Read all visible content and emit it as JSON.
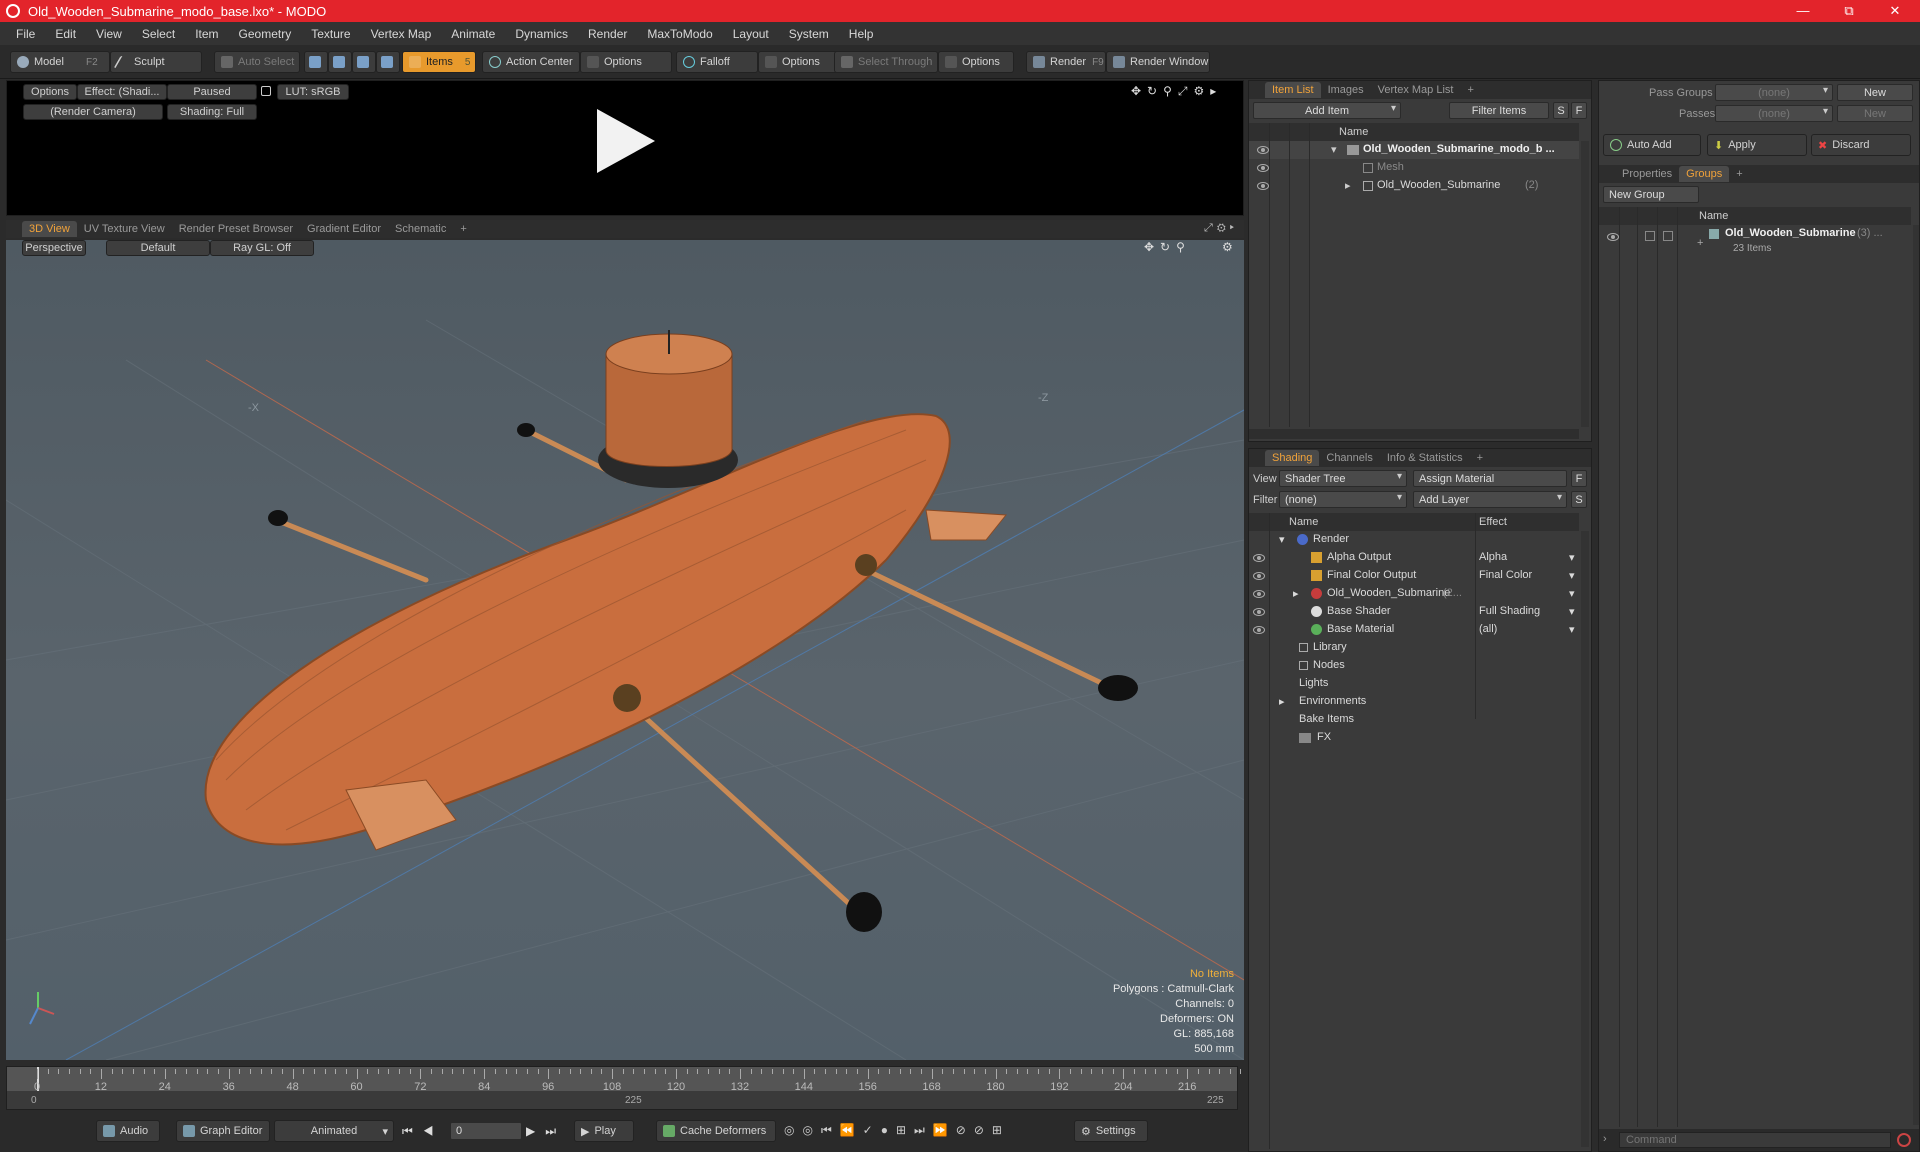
{
  "window": {
    "title": "Old_Wooden_Submarine_modo_base.lxo* - MODO",
    "minimize": "—",
    "maximize": "⧉",
    "close": "✕"
  },
  "menu": [
    "File",
    "Edit",
    "View",
    "Select",
    "Item",
    "Geometry",
    "Texture",
    "Vertex Map",
    "Animate",
    "Dynamics",
    "Render",
    "MaxToModo",
    "Layout",
    "System",
    "Help"
  ],
  "toolbar": {
    "model": "Model",
    "model_key": "F2",
    "sculpt": "Sculpt",
    "auto_select": "Auto Select",
    "items": "Items",
    "items_key": "5",
    "action_center": "Action Center",
    "options1": "Options",
    "falloff": "Falloff",
    "options2": "Options",
    "select_through": "Select Through",
    "options3": "Options",
    "render": "Render",
    "render_key": "F9",
    "render_window": "Render Window"
  },
  "preview": {
    "options": "Options",
    "effect": "Effect: (Shadi...",
    "paused": "Paused",
    "lut": "LUT: sRGB",
    "camera": "(Render Camera)",
    "shading": "Shading: Full"
  },
  "view_tabs": [
    "3D View",
    "UV Texture View",
    "Render Preset Browser",
    "Gradient Editor",
    "Schematic",
    "+"
  ],
  "viewport": {
    "perspective": "Perspective",
    "default": "Default",
    "raygl": "Ray GL: Off",
    "axis_x": "-X",
    "axis_z": "-Z",
    "info": {
      "no_items": "No Items",
      "polygons": "Polygons : Catmull-Clark",
      "channels": "Channels: 0",
      "deformers": "Deformers: ON",
      "gl": "GL: 885,168",
      "scale": "500 mm"
    }
  },
  "timeline": {
    "ticks": [
      "0",
      "12",
      "24",
      "36",
      "48",
      "60",
      "72",
      "84",
      "96",
      "108",
      "120",
      "132",
      "144",
      "156",
      "168",
      "180",
      "192",
      "204",
      "216"
    ],
    "start": "0",
    "mid": "225",
    "end": "225"
  },
  "bottombar": {
    "audio": "Audio",
    "graph_editor": "Graph Editor",
    "animated": "Animated",
    "frame": "0",
    "play": "Play",
    "cache_deformers": "Cache Deformers",
    "settings": "Settings"
  },
  "itemlist": {
    "tabs": [
      "Item List",
      "Images",
      "Vertex Map List",
      "+"
    ],
    "add_item": "Add Item",
    "filter_items": "Filter Items",
    "s": "S",
    "f": "F",
    "col_name": "Name",
    "rows": [
      {
        "label": "Old_Wooden_Submarine_modo_b ...",
        "bold": true
      },
      {
        "label": "Mesh",
        "dim": true
      },
      {
        "label": "Old_Wooden_Submarine",
        "count": "(2)"
      }
    ]
  },
  "shading": {
    "tabs": [
      "Shading",
      "Channels",
      "Info & Statistics",
      "+"
    ],
    "view_label": "View",
    "view_value": "Shader Tree",
    "assign_material": "Assign Material",
    "f": "F",
    "filter_label": "Filter",
    "filter_value": "(none)",
    "add_layer": "Add Layer",
    "s": "S",
    "col_name": "Name",
    "col_effect": "Effect",
    "rows": [
      {
        "label": "Render",
        "effect": ""
      },
      {
        "label": "Alpha Output",
        "effect": "Alpha"
      },
      {
        "label": "Final Color Output",
        "effect": "Final Color"
      },
      {
        "label": "Old_Wooden_Submarine",
        "extra": "(2...",
        "effect": ""
      },
      {
        "label": "Base Shader",
        "effect": "Full Shading"
      },
      {
        "label": "Base Material",
        "effect": "(all)"
      },
      {
        "label": "Library",
        "effect": ""
      },
      {
        "label": "Nodes",
        "effect": ""
      },
      {
        "label": "Lights",
        "effect": ""
      },
      {
        "label": "Environments",
        "effect": ""
      },
      {
        "label": "Bake Items",
        "effect": ""
      },
      {
        "label": "FX",
        "effect": ""
      }
    ]
  },
  "groups": {
    "pass_groups_label": "Pass Groups",
    "pass_groups_value": "(none)",
    "passes_label": "Passes",
    "passes_value": "(none)",
    "new1": "New",
    "new2": "New",
    "auto_add": "Auto Add",
    "apply": "Apply",
    "discard": "Discard",
    "tabs": [
      "Properties",
      "Groups",
      "+"
    ],
    "new_group": "New Group",
    "col_name": "Name",
    "group_name": "Old_Wooden_Submarine",
    "group_count": "(3) ...",
    "group_items": "23 Items"
  },
  "command": {
    "placeholder": "Command"
  }
}
